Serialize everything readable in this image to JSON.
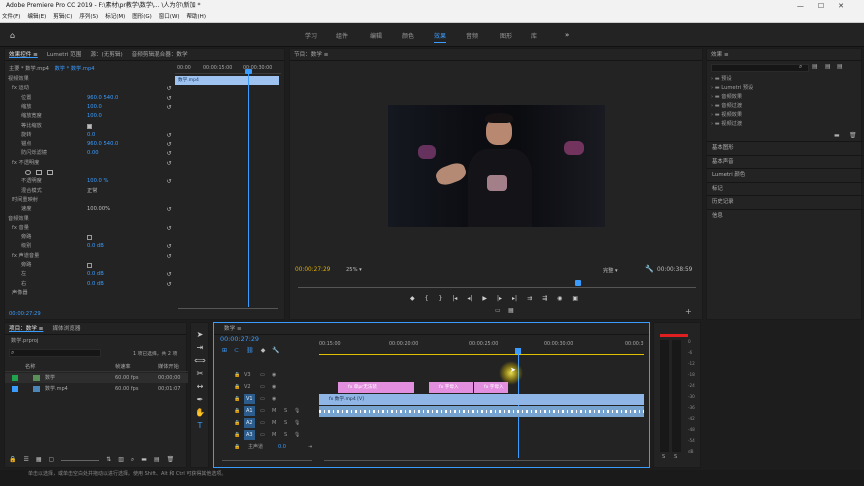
{
  "titlebar": {
    "title": "Adobe Premiere Pro CC 2019 - F:\\素材\\pr教学\\数学\\... \\人为尔\\新加 *"
  },
  "menu": [
    "文件(F)",
    "编辑(E)",
    "剪辑(C)",
    "序列(S)",
    "标记(M)",
    "图形(G)",
    "窗口(W)",
    "帮助(H)"
  ],
  "workspaces": [
    "学习",
    "组件",
    "编辑",
    "颜色",
    "效果",
    "音频",
    "图形",
    "库"
  ],
  "left_panel": {
    "tabs": [
      "效果控件 ≡",
      "Lumetri 范围",
      "源：(无剪辑)",
      "音频剪辑混合器：数学"
    ],
    "clip": "主要 * 数学.mp4",
    "seq": "数学 * 数学.mp4",
    "mini_tc": [
      "00:00",
      "00:00:15:00",
      "00:00:30:00"
    ],
    "mini_clip": "数学.mp4",
    "rows": [
      {
        "t": "视频效果",
        "v": ""
      },
      {
        "t": "fx 运动",
        "v": ""
      },
      {
        "t": "位置",
        "v": "960.0   540.0"
      },
      {
        "t": "缩放",
        "v": "100.0"
      },
      {
        "t": "缩放宽度",
        "v": "100.0"
      },
      {
        "t": "等比缩放",
        "v": ""
      },
      {
        "t": "旋转",
        "v": "0.0"
      },
      {
        "t": "锚点",
        "v": "960.0   540.0"
      },
      {
        "t": "防闪烁滤镜",
        "v": "0.00"
      },
      {
        "t": "fx 不透明度",
        "v": ""
      },
      {
        "t": "",
        "v": ""
      },
      {
        "t": "不透明度",
        "v": "100.0 %"
      },
      {
        "t": "混合模式",
        "v": "正常"
      },
      {
        "t": "时间重映射",
        "v": ""
      },
      {
        "t": "速度",
        "v": "100.00%"
      },
      {
        "t": "音频效果",
        "v": ""
      },
      {
        "t": "fx 音量",
        "v": ""
      },
      {
        "t": "旁路",
        "v": ""
      },
      {
        "t": "级别",
        "v": "0.0 dB"
      },
      {
        "t": "fx 声道音量",
        "v": ""
      },
      {
        "t": "旁路",
        "v": ""
      },
      {
        "t": "左",
        "v": "0.0 dB"
      },
      {
        "t": "右",
        "v": "0.0 dB"
      },
      {
        "t": "声像器",
        "v": ""
      }
    ],
    "timecode": "00:00:27:29"
  },
  "program": {
    "tab": "节目：数学 ≡",
    "tc": "00:00:27:29",
    "zoom": "25%",
    "quality": "完整",
    "duration": "00:00:38:59"
  },
  "effects_panel": {
    "tab": "效果 ≡",
    "tree": [
      "预设",
      "Lumetri 预设",
      "音频效果",
      "音频过渡",
      "视频效果",
      "视频过渡"
    ],
    "sections": [
      "基本图形",
      "基本声音",
      "Lumetri 颜色",
      "标记",
      "历史记录",
      "信息"
    ]
  },
  "project": {
    "tabs": [
      "项目：数学 ≡",
      "媒体浏览器"
    ],
    "file": "数学.prproj",
    "count": "1 项已选择，共 2 项",
    "cols": [
      "名称",
      "帧速率",
      "媒体开始"
    ],
    "items": [
      {
        "name": "数学",
        "fps": "60.00 fps",
        "start": "00;00;00"
      },
      {
        "name": "数学.mp4",
        "fps": "60.00 fps",
        "start": "00;01:07"
      }
    ]
  },
  "timeline": {
    "tab": "数学 ≡",
    "tc": "00:00:27:29",
    "ruler": [
      "00:15:00",
      "00:00:20:00",
      "00:00:25:00",
      "00:00:30:00",
      "00:00:3"
    ],
    "tracks": [
      "V3",
      "V2",
      "V1",
      "A1",
      "A2",
      "A3",
      "主声道"
    ],
    "master_val": "0.0",
    "clips": [
      {
        "label": "fx 数学.mp4 [V]"
      },
      {
        "label": "fx 单pr无法装"
      },
      {
        "label": "fx 字母入"
      },
      {
        "label": "fx 字母入"
      }
    ]
  },
  "meter": {
    "labels": [
      "0",
      "-6",
      "-12",
      "-18",
      "-24",
      "-30",
      "-36",
      "-42",
      "-48",
      "-54",
      "dB"
    ],
    "bottom": [
      "S",
      "S"
    ]
  },
  "statusbar": "单击以选择，或单击空白处并拖动以进行选择。使用 Shift、Alt 和 Ctrl 可获得其他选项。"
}
